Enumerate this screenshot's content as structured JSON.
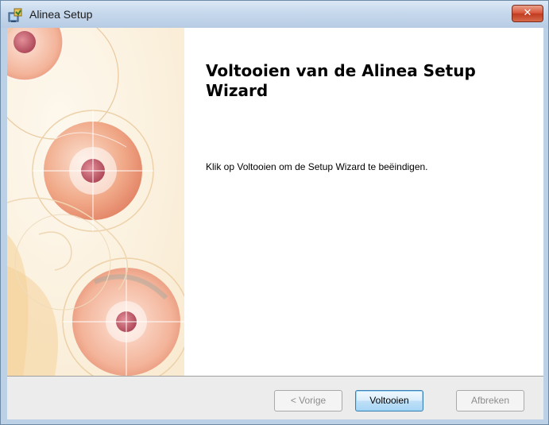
{
  "window": {
    "title": "Alinea Setup",
    "close_glyph": "✕"
  },
  "content": {
    "heading": "Voltooien van de Alinea Setup Wizard",
    "description": "Klik op Voltooien om de Setup Wizard te beëindigen."
  },
  "buttons": {
    "back": "< Vorige",
    "finish": "Voltooien",
    "cancel": "Afbreken"
  },
  "states": {
    "back_enabled": false,
    "finish_enabled": true,
    "cancel_enabled": false
  },
  "icons": {
    "app": "installer-icon",
    "banner": "disc-artwork"
  }
}
